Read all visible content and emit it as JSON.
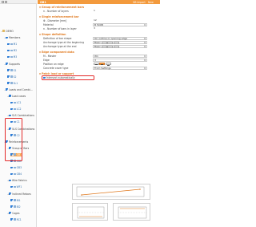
{
  "header": {
    "object": "GB1",
    "actions": [
      "GB Import",
      "New",
      "Copy",
      "Delete"
    ]
  },
  "tree": [
    {
      "label": "DEMO",
      "type": "group",
      "depth": 0,
      "toggle": "−"
    },
    {
      "label": "Members",
      "type": "group",
      "depth": 1,
      "toggle": "−"
    },
    {
      "label": "M1",
      "type": "leaf",
      "depth": 2
    },
    {
      "label": "M2",
      "type": "leaf",
      "depth": 2
    },
    {
      "label": "M3",
      "type": "leaf",
      "depth": 2
    },
    {
      "label": "Supports",
      "type": "group",
      "depth": 1,
      "toggle": "−"
    },
    {
      "label": "S1",
      "type": "leaf",
      "depth": 2
    },
    {
      "label": "S2",
      "type": "leaf",
      "depth": 2
    },
    {
      "label": "SL1",
      "type": "leaf",
      "depth": 2
    },
    {
      "label": "Loads and Combi...",
      "type": "group",
      "depth": 1,
      "toggle": "−"
    },
    {
      "label": "Load cases",
      "type": "group",
      "depth": 2,
      "toggle": "+"
    },
    {
      "label": "LC1",
      "type": "leaf",
      "depth": 3
    },
    {
      "label": "LC2",
      "type": "leaf",
      "depth": 3
    },
    {
      "label": "SLS Combinations",
      "type": "group",
      "depth": 2,
      "toggle": "+"
    },
    {
      "label": "C1",
      "type": "leaf",
      "depth": 3
    },
    {
      "label": "ULS Combinations",
      "type": "group",
      "depth": 2,
      "toggle": "+"
    },
    {
      "label": "C2",
      "type": "leaf",
      "depth": 3
    },
    {
      "label": "Reinforcements",
      "type": "group",
      "depth": 1,
      "toggle": "−"
    },
    {
      "label": "Group of Bars",
      "type": "group",
      "depth": 2,
      "toggle": "−"
    },
    {
      "label": "GB1",
      "type": "leaf",
      "depth": 3,
      "selected": true
    },
    {
      "label": "GB2",
      "type": "leaf",
      "depth": 3
    },
    {
      "label": "GB3",
      "type": "leaf",
      "depth": 3
    },
    {
      "label": "GB4",
      "type": "leaf",
      "depth": 3
    },
    {
      "label": "Wire Fabrics",
      "type": "group",
      "depth": 2,
      "toggle": "+"
    },
    {
      "label": "WF1",
      "type": "leaf",
      "depth": 3
    },
    {
      "label": "Inclined Rebars",
      "type": "group",
      "depth": 2,
      "toggle": "+"
    },
    {
      "label": "IB1",
      "type": "leaf",
      "depth": 3
    },
    {
      "label": "IB2",
      "type": "leaf",
      "depth": 3
    },
    {
      "label": "Cages",
      "type": "group",
      "depth": 2,
      "toggle": "+"
    },
    {
      "label": "RC1",
      "type": "leaf",
      "depth": 3
    }
  ],
  "sections": {
    "group": "Group of reinforcement bars",
    "single": "Single reinforcement bar",
    "shape": "Shape definition",
    "edge": "Edge component data",
    "patch": "Patch load or support"
  },
  "fields": {
    "number_of_layers": {
      "label": "n - Number of layers",
      "value": "1"
    },
    "diameter": {
      "label": "Φ - Diameter [mm]",
      "value": "12"
    },
    "material": {
      "label": "Material",
      "value": "B 500B"
    },
    "bars_in_layer": {
      "label": "n - Number of bars in layer",
      "value": "3"
    },
    "definition": {
      "label": "Definition of bar shape",
      "value": "On outline or opening edge"
    },
    "anchor_begin": {
      "label": "Anchorage type at the beginning",
      "value": "Basic"
    },
    "anchor_end": {
      "label": "Anchorage type at the end",
      "value": "Basic"
    },
    "master": {
      "label": "M - Master",
      "value": "W1"
    },
    "edge": {
      "label": "Edge",
      "value": "3"
    },
    "position": {
      "label": "Position on edge"
    },
    "cover": {
      "label": "Concrete cover type",
      "value": "From Settings"
    },
    "intersect": {
      "label": "Intersect automatically",
      "checked": true
    }
  }
}
